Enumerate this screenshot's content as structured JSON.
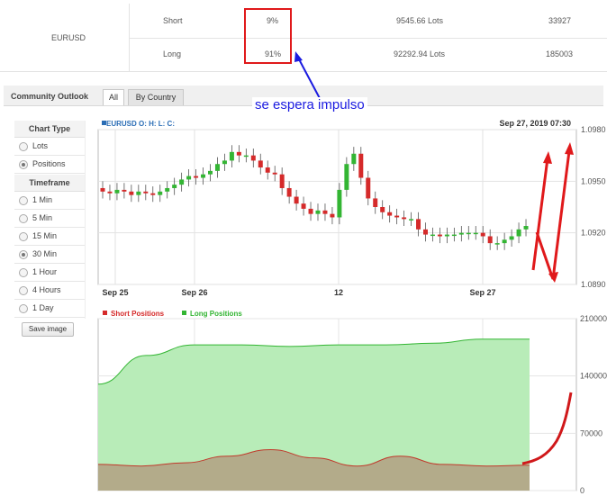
{
  "sentiment_table": {
    "symbol": "EURUSD",
    "rows": [
      {
        "side": "Short",
        "percent": "9%",
        "lots": "9545.66 Lots",
        "positions": "33927"
      },
      {
        "side": "Long",
        "percent": "91%",
        "lots": "92292.94 Lots",
        "positions": "185003"
      }
    ]
  },
  "annotation": {
    "text": "se espera impulso",
    "highlight_color": "#e0191b",
    "arrow_color": "#1b1be0"
  },
  "community": {
    "title": "Community Outlook",
    "tabs": [
      {
        "label": "All",
        "active": true
      },
      {
        "label": "By Country",
        "active": false
      }
    ]
  },
  "sidebar": {
    "chart_type_title": "Chart Type",
    "chart_types": [
      {
        "label": "Lots",
        "selected": false
      },
      {
        "label": "Positions",
        "selected": true
      }
    ],
    "timeframe_title": "Timeframe",
    "timeframes": [
      {
        "label": "1 Min",
        "selected": false
      },
      {
        "label": "5 Min",
        "selected": false
      },
      {
        "label": "15 Min",
        "selected": false
      },
      {
        "label": "30 Min",
        "selected": true
      },
      {
        "label": "1 Hour",
        "selected": false
      },
      {
        "label": "4 Hours",
        "selected": false
      },
      {
        "label": "1 Day",
        "selected": false
      }
    ],
    "save_label": "Save image"
  },
  "price_chart": {
    "legend": "EURUSD O: H: L: C:",
    "legend_color": "#2a6db5",
    "timestamp": "Sep 27, 2019 07:30",
    "yticks": [
      "1.0980",
      "1.0950",
      "1.0920",
      "1.0890"
    ],
    "xticks": [
      "Sep 25",
      "Sep 26",
      "12",
      "Sep 27"
    ],
    "up_color": "#33b533",
    "down_color": "#d52a2a"
  },
  "positions_chart": {
    "legend": [
      {
        "label": "Short Positions",
        "color": "#d52a2a"
      },
      {
        "label": "Long Positions",
        "color": "#33b533"
      }
    ],
    "yticks": [
      "210000",
      "140000",
      "70000",
      "0"
    ],
    "long_fill": "#b8ecb8",
    "short_fill": "#b3ab8a"
  },
  "chart_data": [
    {
      "type": "candlestick",
      "symbol": "EURUSD",
      "ylim": [
        1.089,
        1.098
      ],
      "xticks": [
        "Sep 25",
        "Sep 26",
        "12",
        "Sep 27"
      ],
      "close_approx": [
        1.0944,
        1.0943,
        1.0945,
        1.0944,
        1.0942,
        1.0944,
        1.0943,
        1.0942,
        1.0944,
        1.0946,
        1.0948,
        1.0951,
        1.0953,
        1.0952,
        1.0954,
        1.0956,
        1.096,
        1.0962,
        1.0967,
        1.0965,
        1.0965,
        1.0962,
        1.0958,
        1.0955,
        1.0954,
        1.0946,
        1.0941,
        1.0937,
        1.0934,
        1.0931,
        1.0933,
        1.0931,
        1.0929,
        1.0945,
        1.096,
        1.0966,
        1.0952,
        1.094,
        1.0935,
        1.0932,
        1.093,
        1.0929,
        1.0928,
        1.0928,
        1.0922,
        1.0919,
        1.0919,
        1.0918,
        1.0919,
        1.0919,
        1.092,
        1.092,
        1.092,
        1.0918,
        1.0914,
        1.0914,
        1.0916,
        1.0918,
        1.0922,
        1.0924
      ]
    },
    {
      "type": "area",
      "series": [
        {
          "name": "Long Positions",
          "values_approx": [
            130000,
            165000,
            178000,
            178000,
            176000,
            178000,
            178000,
            180000,
            185000,
            185000
          ]
        },
        {
          "name": "Short Positions",
          "values_approx": [
            32000,
            30000,
            34000,
            42000,
            50000,
            40000,
            30000,
            42000,
            32000,
            30000,
            31000,
            35000,
            120000
          ]
        }
      ],
      "ylim": [
        0,
        210000
      ]
    }
  ]
}
